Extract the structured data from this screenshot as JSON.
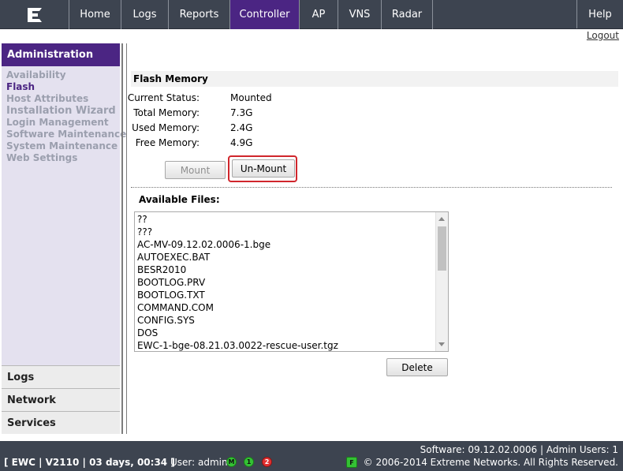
{
  "nav": {
    "logo": "E",
    "items": [
      {
        "label": "Home"
      },
      {
        "label": "Logs"
      },
      {
        "label": "Reports"
      },
      {
        "label": "Controller"
      },
      {
        "label": "AP"
      },
      {
        "label": "VNS"
      },
      {
        "label": "Radar"
      }
    ],
    "help": "Help",
    "logout": "Logout",
    "active_color": "#4b2583",
    "bar_color": "#3d4450"
  },
  "sidebar": {
    "header": "Administration",
    "links": [
      {
        "label": "Availability"
      },
      {
        "label": "Flash"
      },
      {
        "label": "Host Attributes"
      },
      {
        "label": "Installation Wizard"
      },
      {
        "label": "Login Management"
      },
      {
        "label": "Software Maintenance"
      },
      {
        "label": "System Maintenance"
      },
      {
        "label": "Web Settings"
      }
    ],
    "selected": "Flash",
    "sections": [
      {
        "label": "Logs"
      },
      {
        "label": "Network"
      },
      {
        "label": "Services"
      }
    ]
  },
  "main": {
    "section_title": "Flash Memory",
    "status": [
      {
        "key": "Current Status:",
        "value": "Mounted"
      },
      {
        "key": "Total Memory:",
        "value": "7.3G"
      },
      {
        "key": "Used Memory:",
        "value": "2.4G"
      },
      {
        "key": "Free Memory:",
        "value": "4.9G"
      }
    ],
    "mount_label": "Mount",
    "unmount_label": "Un-Mount",
    "files_label": "Available Files:",
    "files": [
      "??",
      "???",
      "AC-MV-09.12.02.0006-1.bge",
      "AUTOEXEC.BAT",
      "BESR2010",
      "BOOTLOG.PRV",
      "BOOTLOG.TXT",
      "COMMAND.COM",
      "CONFIG.SYS",
      "DOS",
      "EWC-1-bge-08.21.03.0022-rescue-user.tgz"
    ],
    "delete_label": "Delete",
    "highlight_color": "#d0262c"
  },
  "footer": {
    "software": "Software: 09.12.02.0006 | Admin Users: 1",
    "copyright": "© 2006-2014  Extreme Networks. All Rights Reserved.",
    "status_left": "[ EWC | V2110 | 03 days, 00:34 ]",
    "user": "User: admin",
    "indicators": [
      {
        "label": "M",
        "color": "green"
      },
      {
        "label": "1",
        "color": "green"
      },
      {
        "label": "2",
        "color": "red"
      }
    ],
    "flag": "F"
  }
}
